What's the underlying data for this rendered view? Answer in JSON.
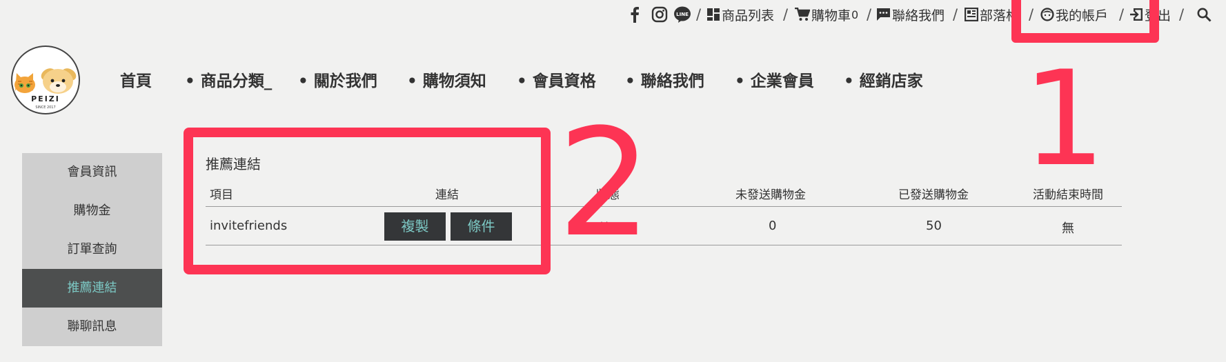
{
  "topbar": {
    "icons": [
      "facebook-icon",
      "instagram-icon",
      "line-icon"
    ],
    "product_list": "商品列表",
    "cart": "購物車",
    "cart_count": "0",
    "contact": "聯絡我們",
    "blog": "部落格",
    "account": "我的帳戶",
    "logout": "登出"
  },
  "logo": {
    "text": "PEIZI",
    "sub": "SINCE 2017"
  },
  "nav": [
    "首頁",
    "• 商品分類_",
    "• 關於我們",
    "• 購物須知",
    "• 會員資格",
    "• 聯絡我們",
    "• 企業會員",
    "• 經銷店家"
  ],
  "sidebar": [
    "會員資訊",
    "購物金",
    "訂單查詢",
    "推薦連結",
    "聯聊訊息"
  ],
  "panel": {
    "title": "推薦連結",
    "headers": [
      "項目",
      "連結",
      "狀態",
      "未發送購物金",
      "已發送購物金",
      "活動結束時間"
    ],
    "row": {
      "item": "invitefriends",
      "copy_button": "複製",
      "terms_button": "條件",
      "status": "啟用",
      "unsent": "0",
      "sent": "50",
      "end_time": "無"
    }
  },
  "annotations": {
    "label_1": "1",
    "label_2": "2",
    "color": "#fd3454"
  },
  "colors": {
    "accent": "#7cc8c4",
    "active_bg": "#4d4f4f",
    "button_bg": "#343638"
  }
}
